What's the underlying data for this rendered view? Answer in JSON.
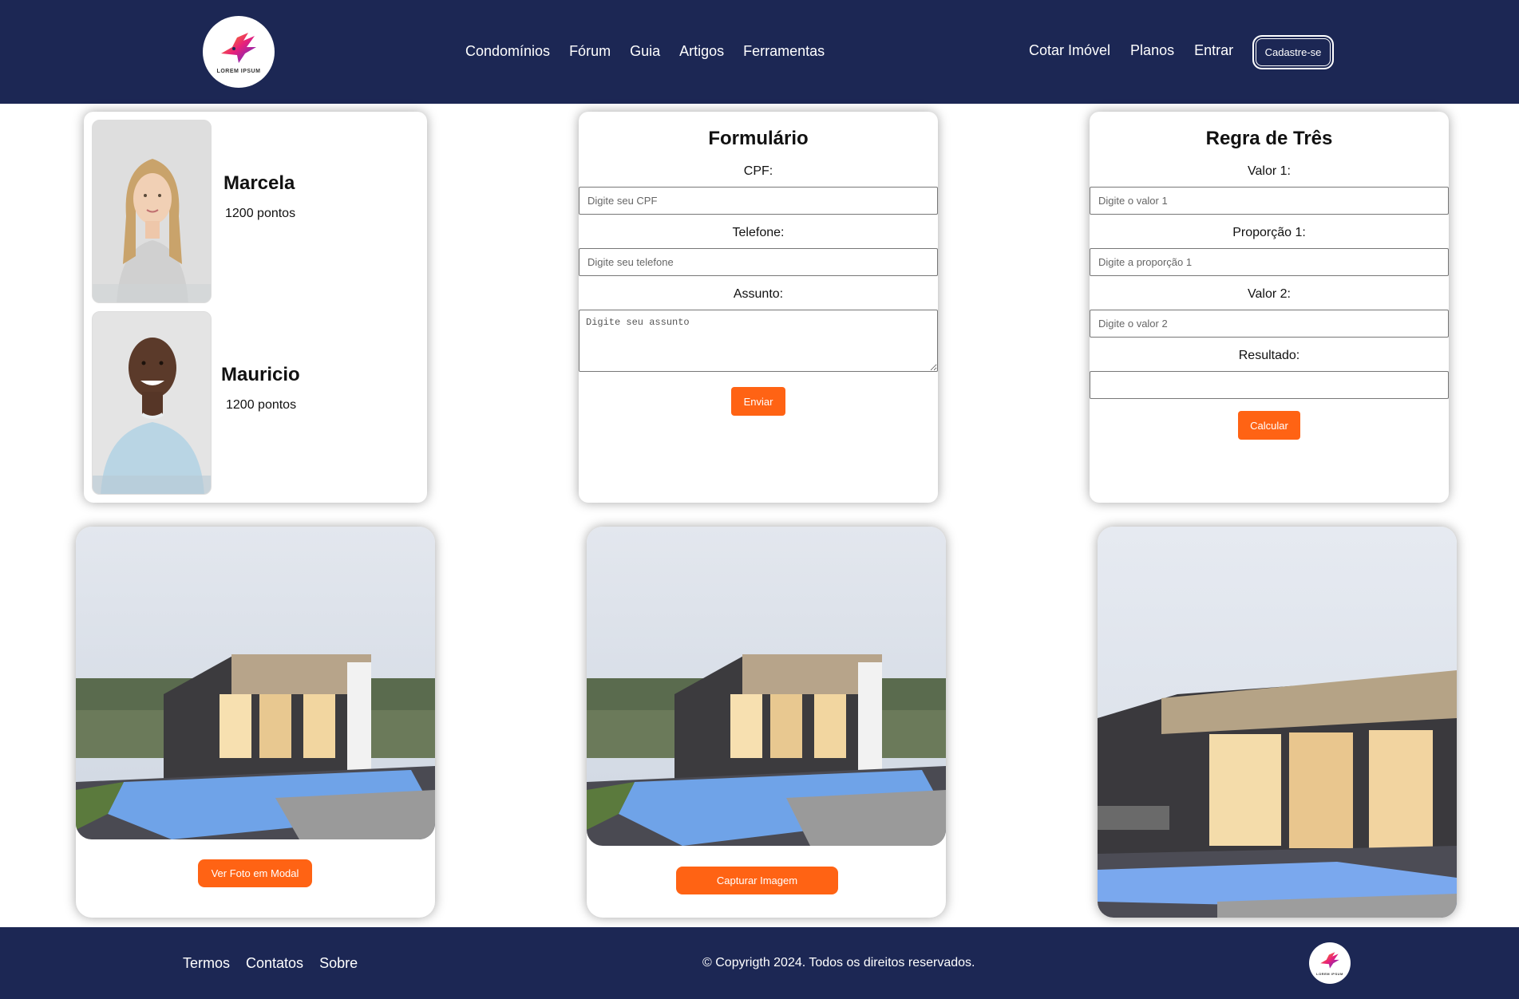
{
  "header": {
    "logo_text": "LOREM IPSUM",
    "nav_left": [
      "Condomínios",
      "Fórum",
      "Guia",
      "Artigos",
      "Ferramentas"
    ],
    "nav_right": [
      "Cotar Imóvel",
      "Planos",
      "Entrar"
    ],
    "signup_label": "Cadastre-se"
  },
  "ranking": {
    "users": [
      {
        "name": "Marcela",
        "points": "1200 pontos"
      },
      {
        "name": "Mauricio",
        "points": "1200 pontos"
      }
    ]
  },
  "form": {
    "title": "Formulário",
    "cpf_label": "CPF:",
    "cpf_placeholder": "Digite seu CPF",
    "phone_label": "Telefone:",
    "phone_placeholder": "Digite seu telefone",
    "subject_label": "Assunto:",
    "subject_placeholder": "Digite seu assunto",
    "submit_label": "Enviar"
  },
  "rule_of_three": {
    "title": "Regra de Três",
    "value1_label": "Valor 1:",
    "value1_placeholder": "Digite o valor 1",
    "ratio1_label": "Proporção 1:",
    "ratio1_placeholder": "Digite a proporção 1",
    "value2_label": "Valor 2:",
    "value2_placeholder": "Digite o valor 2",
    "result_label": "Resultado:",
    "result_value": "",
    "calculate_label": "Calcular"
  },
  "photos": {
    "modal_button_label": "Ver Foto em Modal",
    "capture_button_label": "Capturar Imagem"
  },
  "footer": {
    "links": [
      "Termos",
      "Contatos",
      "Sobre"
    ],
    "copyright": "© Copyrigth 2024. Todos os direitos reservados."
  },
  "colors": {
    "navy": "#1c2754",
    "accent_orange": "#ff6314"
  }
}
